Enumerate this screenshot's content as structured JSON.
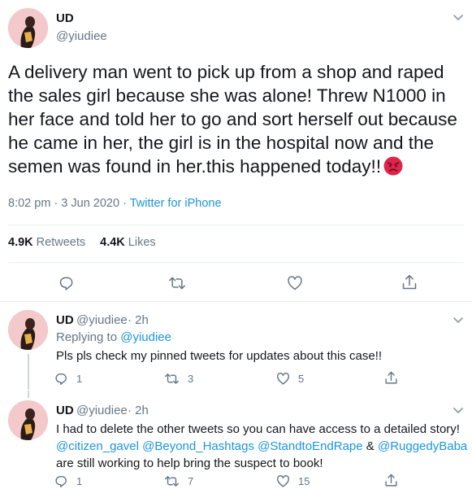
{
  "main_tweet": {
    "display_name": "UD",
    "handle": "@yiudiee",
    "text": "A delivery man went to pick up from a shop and raped the sales girl because she was alone! Threw N1000 in her face and told her to go and sort herself out because he came in her, the girl is in the hospital now and the semen was found in her.this happened today!!",
    "emoji": "angry-face-emoji",
    "time": "8:02 pm",
    "date": "3 Jun 2020",
    "source": "Twitter for iPhone",
    "retweets_count": "4.9K",
    "retweets_label": "Retweets",
    "likes_count": "4.4K",
    "likes_label": "Likes",
    "icons": [
      "reply-icon",
      "retweet-icon",
      "like-icon",
      "share-icon"
    ]
  },
  "replies": [
    {
      "display_name": "UD",
      "handle": "@yiudiee",
      "age": "2h",
      "replying_prefix": "Replying to",
      "replying_to": "@yiudiee",
      "text": "Pls pls check my pinned tweets for updates about this case!!",
      "reply_count": "1",
      "retweet_count": "3",
      "like_count": "5"
    },
    {
      "display_name": "UD",
      "handle": "@yiudiee",
      "age": "2h",
      "line1": "I had to delete the other tweets so you can have access to a detailed story!",
      "mention1": "@citizen_gavel",
      "mention2": "@Beyond_Hashtags",
      "mention3": "@StandtoEndRape",
      "amp": "&",
      "mention4": "@RuggedyBaba",
      "line3": "are still working to help bring the suspect to book!",
      "reply_count": "1",
      "retweet_count": "7",
      "like_count": "15"
    }
  ],
  "colors": {
    "link": "#1b95e0",
    "secondary_text": "#657786",
    "divider": "#e6ecf0",
    "angry_emoji": "#e0244a"
  }
}
